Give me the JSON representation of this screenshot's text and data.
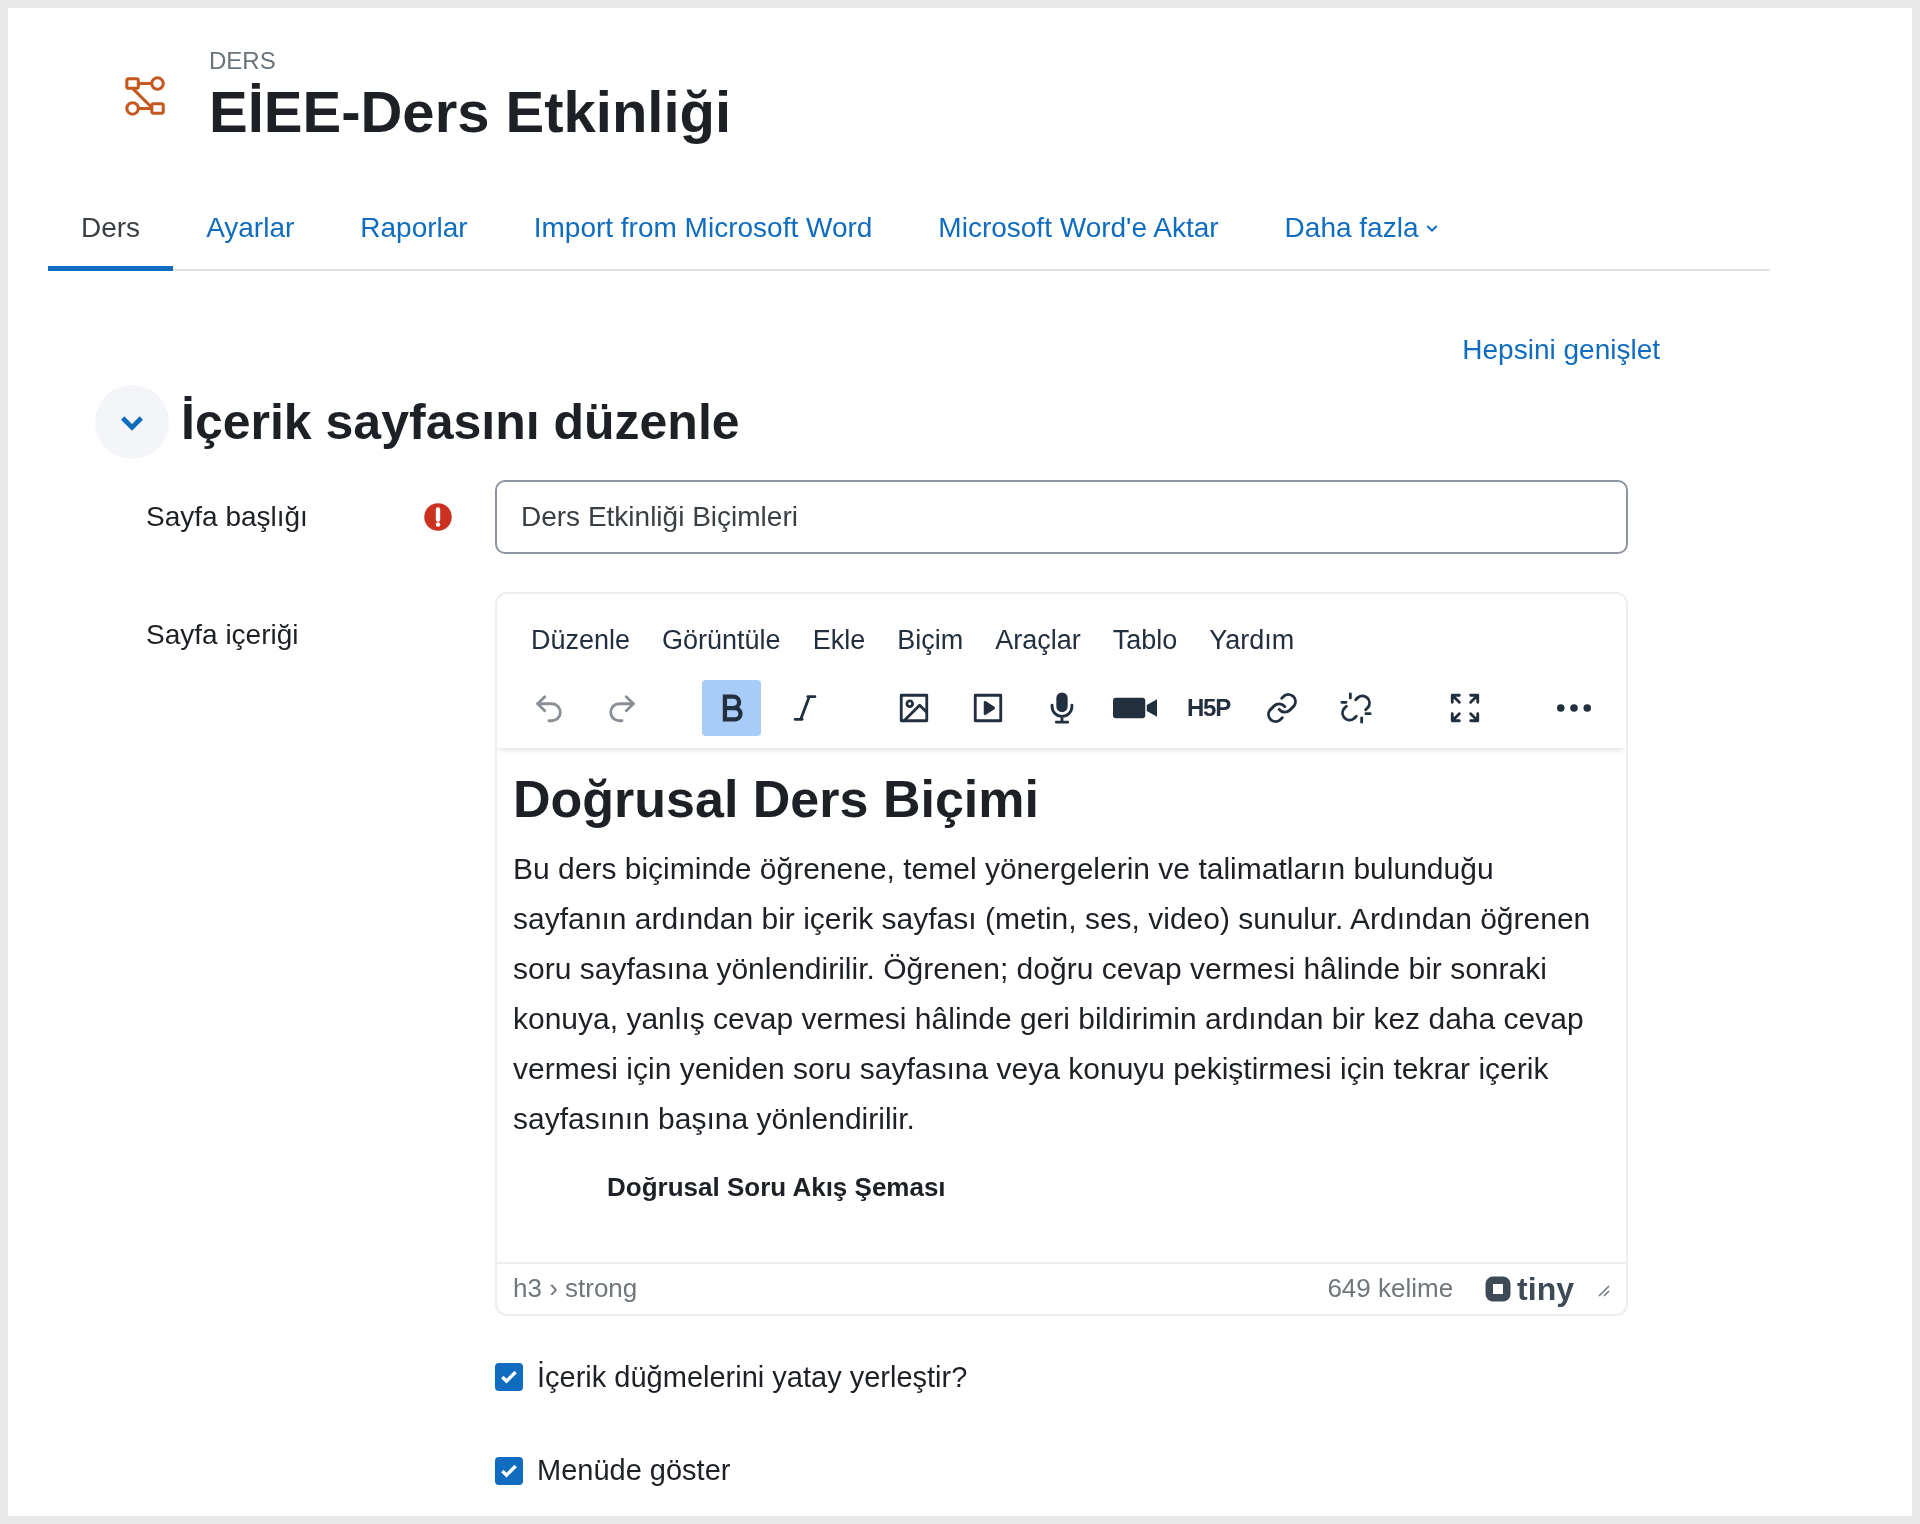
{
  "header": {
    "eyebrow": "DERS",
    "title": "EİEE-Ders Etkinliği"
  },
  "tabs": [
    {
      "label": "Ders",
      "selected": true
    },
    {
      "label": "Ayarlar",
      "selected": false
    },
    {
      "label": "Raporlar",
      "selected": false
    },
    {
      "label": "Import from Microsoft Word",
      "selected": false
    },
    {
      "label": "Microsoft Word'e Aktar",
      "selected": false
    },
    {
      "label": "Daha fazla",
      "selected": false,
      "kind": "dropdown"
    }
  ],
  "expand_all": "Hepsini genişlet",
  "section": {
    "title": "İçerik sayfasını düzenle",
    "expanded": true
  },
  "fields": {
    "title_label": "Sayfa başlığı",
    "title_required": true,
    "title_value": "Ders Etkinliği Biçimleri",
    "content_label": "Sayfa içeriği"
  },
  "editor": {
    "menu": [
      "Düzenle",
      "Görüntüle",
      "Ekle",
      "Biçim",
      "Araçlar",
      "Tablo",
      "Yardım"
    ],
    "toolbar": [
      {
        "kind": "undo",
        "selected": false
      },
      {
        "kind": "redo",
        "selected": false
      },
      {
        "kind": "gap"
      },
      {
        "kind": "bold",
        "selected": true
      },
      {
        "kind": "italic",
        "selected": false
      },
      {
        "kind": "gap"
      },
      {
        "kind": "image",
        "selected": false
      },
      {
        "kind": "media",
        "selected": false
      },
      {
        "kind": "mic",
        "selected": false
      },
      {
        "kind": "video",
        "selected": false
      },
      {
        "kind": "h5p",
        "label": "H5P",
        "selected": false
      },
      {
        "kind": "link",
        "selected": false
      },
      {
        "kind": "unlink",
        "selected": false
      },
      {
        "kind": "gap"
      },
      {
        "kind": "fullscreen",
        "selected": false
      },
      {
        "kind": "gap"
      },
      {
        "kind": "more",
        "selected": false
      }
    ],
    "heading": "Doğrusal Ders Biçimi",
    "paragraph": "Bu ders biçiminde öğrenene, temel yönergelerin ve talimatların bulunduğu sayfanın ardından bir içerik sayfası (metin, ses, video) sunulur. Ardından öğrenen soru sayfasına yönlendirilir. Öğrenen; doğru cevap vermesi hâlinde bir sonraki konuya, yanlış cevap vermesi hâlinde geri bildirimin ardından bir kez daha cevap vermesi için yeniden soru sayfasına veya konuyu pekiştirmesi için tekrar içerik sayfasının başına yönlendirilir.",
    "subheading": "Doğrusal Soru Akış Şeması",
    "path": "h3 › strong",
    "word_count": "649 kelime",
    "brand": "tiny"
  },
  "options": [
    {
      "label": "İçerik düğmelerini yatay yerleştir?",
      "checked": true
    },
    {
      "label": "Menüde göster",
      "checked": true
    }
  ]
}
